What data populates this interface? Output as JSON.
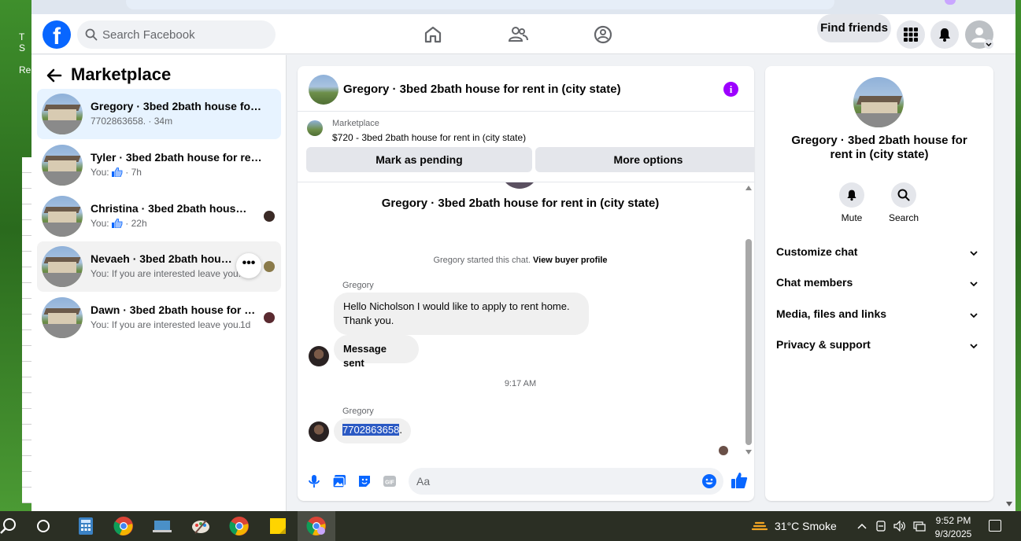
{
  "desktop": {
    "fragment_letters": "T\nS\n\nRe"
  },
  "nav": {
    "logo": "f",
    "search_placeholder": "Search Facebook",
    "find_friends": "Find friends"
  },
  "marketplace": {
    "title": "Marketplace",
    "conversations": [
      {
        "name": "Gregory · 3bed 2bath house for rent in (city state)",
        "sub": "7702863658. · 34m",
        "active": true
      },
      {
        "name": "Tyler · 3bed 2bath house for rent in (city state)",
        "sub_prefix": "You:",
        "sub_suffix": " · 7h"
      },
      {
        "name": "Christina · 3bed 2bath house for rent in (city state)",
        "sub_prefix": "You:",
        "sub_suffix": " · 22h"
      },
      {
        "name": "Nevaeh · 3bed 2bath house for rent in (city state)",
        "sub": "You: If you are interested leave you...",
        "more": "•••"
      },
      {
        "name": "Dawn · 3bed 2bath house for rent in (city state)",
        "sub": "You: If you are interested leave you...",
        "time": "1d"
      }
    ]
  },
  "chat": {
    "header_title": "Gregory · 3bed 2bath house for rent in (city state)",
    "info_icon_label": "i",
    "listing": {
      "source": "Marketplace",
      "description": "$720 - 3bed 2bath house for rent in (city state)",
      "mark_pending": "Mark as pending",
      "more_options": "More options"
    },
    "thread": {
      "big_name": "Gregory · 3bed 2bath house for rent in (city state)",
      "started_text": "Gregory started this chat.",
      "view_profile": "View buyer profile",
      "sender1": "Gregory",
      "msg1": "Hello Nicholson I would like to apply to rent home.",
      "msg1b": "Thank you.",
      "msg2": "Message sent",
      "time": "9:17 AM",
      "sender2": "Gregory",
      "msg3_selected": "7702863658",
      "msg3_rest": "."
    },
    "composer_placeholder": "Aa"
  },
  "details": {
    "name": "Gregory · 3bed 2bath house for rent in (city state)",
    "mute": "Mute",
    "search": "Search",
    "rows": [
      "Customize chat",
      "Chat members",
      "Media, files and links",
      "Privacy & support"
    ]
  },
  "taskbar": {
    "weather": "31°C  Smoke",
    "time": "9:52 PM",
    "date": "9/3/2025"
  },
  "colors": {
    "fb_blue": "#0866ff",
    "messenger_purple": "#9d00ff",
    "active_bg": "#e7f3ff"
  }
}
